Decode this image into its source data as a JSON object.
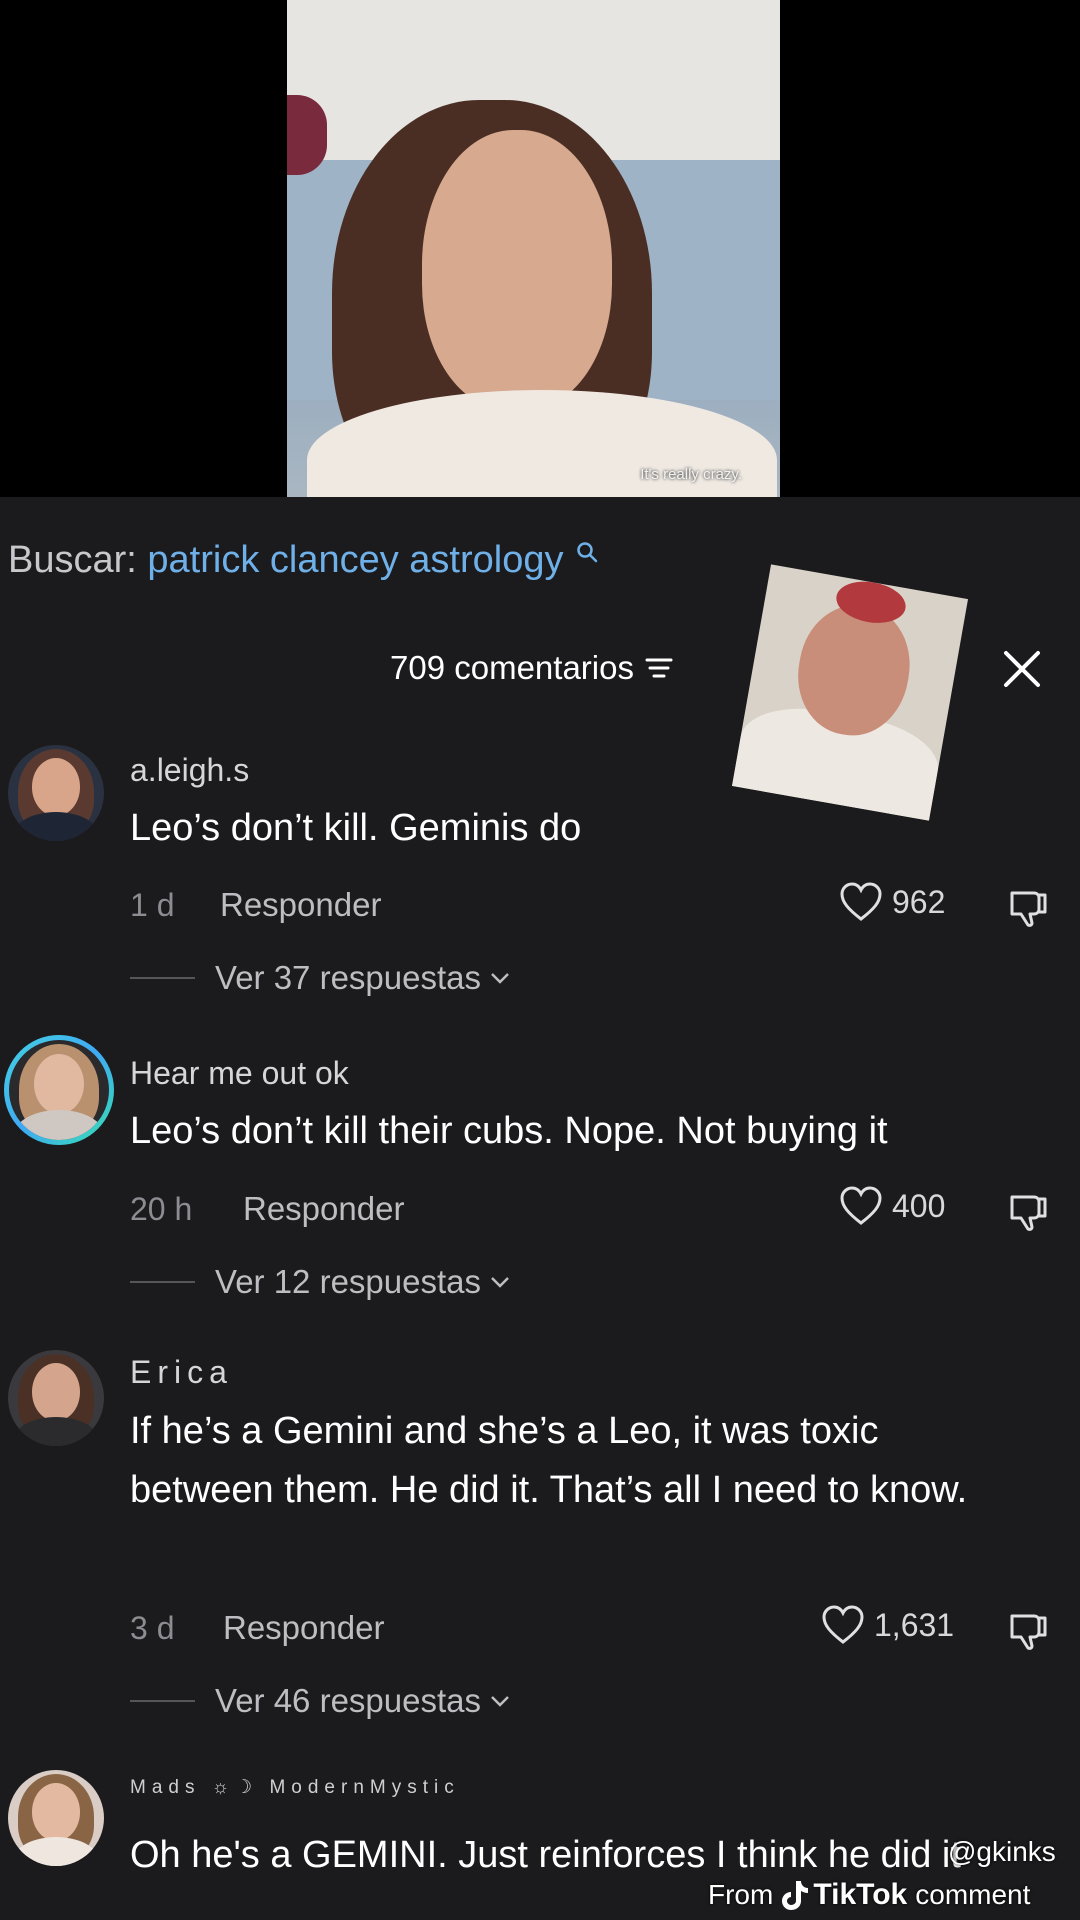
{
  "video": {
    "caption": "It's really crazy."
  },
  "search": {
    "prefix": "Buscar:",
    "query": "patrick clancey astrology"
  },
  "header": {
    "comments_count": "709 comentarios"
  },
  "comments": [
    {
      "username": "a.leigh.s",
      "text": "Leo’s don’t kill. Geminis do",
      "time": "1 d",
      "reply_label": "Responder",
      "likes": "962",
      "replies_label": "Ver 37 respuestas"
    },
    {
      "username": "Hear me out ok",
      "text": "Leo’s don’t kill their cubs. Nope. Not buying it",
      "time": "20 h",
      "reply_label": "Responder",
      "likes": "400",
      "replies_label": "Ver 12 respuestas"
    },
    {
      "username": "Erica",
      "text": "If he’s a Gemini and she’s a Leo, it was toxic between them. He did it. That’s all I need to know.",
      "time": "3 d",
      "reply_label": "Responder",
      "likes": "1,631",
      "replies_label": "Ver 46 respuestas"
    },
    {
      "username": "Mads ☼☽ ModernMystic",
      "text": "Oh he's a GEMINI. Just reinforces I think he did it"
    }
  ],
  "watermark": {
    "handle": "@gkinks",
    "prefix": "From",
    "brand": "TikTok",
    "suffix": "comment"
  },
  "colors": {
    "panel_bg": "#1b1b1d",
    "search_query": "#6fb0e8",
    "avatar_ring": "#44d3e0"
  }
}
